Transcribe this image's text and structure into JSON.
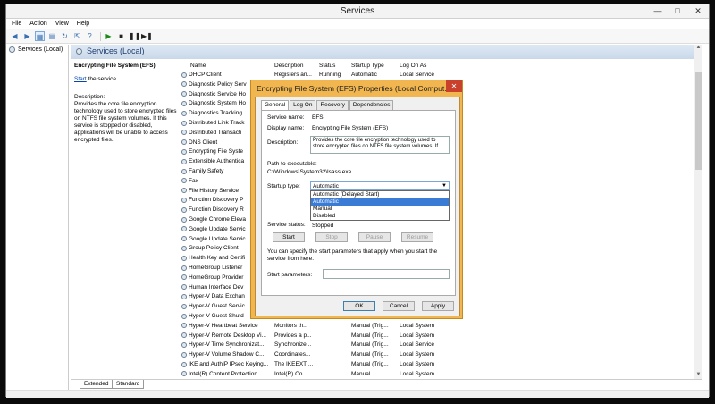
{
  "window": {
    "title": "Services",
    "min_icon": "minimize-icon",
    "max_icon": "maximize-icon",
    "close_icon": "close-icon"
  },
  "menu": [
    "File",
    "Action",
    "View",
    "Help"
  ],
  "toolbar": {
    "icons": [
      "back-icon",
      "forward-icon",
      "show-hide-tree-icon",
      "properties-icon",
      "refresh-icon",
      "export-icon",
      "help-icon",
      "start-icon",
      "stop-icon",
      "pause-icon",
      "restart-icon"
    ]
  },
  "tree": {
    "root": "Services (Local)"
  },
  "panel_header": "Services (Local)",
  "description_pane": {
    "service_title": "Encrypting File System (EFS)",
    "start_link": "Start",
    "start_suffix": " the service",
    "desc_label": "Description:",
    "desc_text": "Provides the core file encryption technology used to store encrypted files on NTFS file system volumes. If this service is stopped or disabled, applications will be unable to access encrypted files."
  },
  "columns": {
    "name": "Name",
    "description": "Description",
    "status": "Status",
    "startup": "Startup Type",
    "logon": "Log On As"
  },
  "services": [
    {
      "name": "DHCP Client",
      "description": "Registers an...",
      "status": "Running",
      "startup": "Automatic",
      "logon": "Local Service"
    },
    {
      "name": "Diagnostic Policy Serv",
      "description": "",
      "status": "",
      "startup": "",
      "logon": ""
    },
    {
      "name": "Diagnostic Service Ho",
      "description": "",
      "status": "",
      "startup": "",
      "logon": ""
    },
    {
      "name": "Diagnostic System Ho",
      "description": "",
      "status": "",
      "startup": "",
      "logon": ""
    },
    {
      "name": "Diagnostics Tracking",
      "description": "",
      "status": "",
      "startup": "",
      "logon": ""
    },
    {
      "name": "Distributed Link Track",
      "description": "",
      "status": "",
      "startup": "",
      "logon": ""
    },
    {
      "name": "Distributed Transacti",
      "description": "",
      "status": "",
      "startup": "",
      "logon": ""
    },
    {
      "name": "DNS Client",
      "description": "",
      "status": "",
      "startup": "",
      "logon": ""
    },
    {
      "name": "Encrypting File Syste",
      "description": "",
      "status": "",
      "startup": "",
      "logon": ""
    },
    {
      "name": "Extensible Authentica",
      "description": "",
      "status": "",
      "startup": "",
      "logon": ""
    },
    {
      "name": "Family Safety",
      "description": "",
      "status": "",
      "startup": "",
      "logon": ""
    },
    {
      "name": "Fax",
      "description": "",
      "status": "",
      "startup": "",
      "logon": ""
    },
    {
      "name": "File History Service",
      "description": "",
      "status": "",
      "startup": "",
      "logon": ""
    },
    {
      "name": "Function Discovery P",
      "description": "",
      "status": "",
      "startup": "",
      "logon": ""
    },
    {
      "name": "Function Discovery R",
      "description": "",
      "status": "",
      "startup": "",
      "logon": ""
    },
    {
      "name": "Google Chrome Eleva",
      "description": "",
      "status": "",
      "startup": "",
      "logon": ""
    },
    {
      "name": "Google Update Servic",
      "description": "",
      "status": "",
      "startup": "",
      "logon": ""
    },
    {
      "name": "Google Update Servic",
      "description": "",
      "status": "",
      "startup": "",
      "logon": ""
    },
    {
      "name": "Group Policy Client",
      "description": "",
      "status": "",
      "startup": "",
      "logon": ""
    },
    {
      "name": "Health Key and Certifi",
      "description": "",
      "status": "",
      "startup": "",
      "logon": ""
    },
    {
      "name": "HomeGroup Listener",
      "description": "",
      "status": "",
      "startup": "",
      "logon": ""
    },
    {
      "name": "HomeGroup Provider",
      "description": "",
      "status": "",
      "startup": "",
      "logon": ""
    },
    {
      "name": "Human Interface Dev",
      "description": "",
      "status": "",
      "startup": "",
      "logon": ""
    },
    {
      "name": "Hyper-V Data Exchan",
      "description": "",
      "status": "",
      "startup": "",
      "logon": ""
    },
    {
      "name": "Hyper-V Guest Servic",
      "description": "",
      "status": "",
      "startup": "",
      "logon": ""
    },
    {
      "name": "Hyper-V Guest Shutd",
      "description": "",
      "status": "",
      "startup": "",
      "logon": ""
    },
    {
      "name": "Hyper-V Heartbeat Service",
      "description": "Monitors th...",
      "status": "",
      "startup": "Manual (Trig...",
      "logon": "Local System"
    },
    {
      "name": "Hyper-V Remote Desktop Vi...",
      "description": "Provides a p...",
      "status": "",
      "startup": "Manual (Trig...",
      "logon": "Local System"
    },
    {
      "name": "Hyper-V Time Synchronizat...",
      "description": "Synchronize...",
      "status": "",
      "startup": "Manual (Trig...",
      "logon": "Local Service"
    },
    {
      "name": "Hyper-V Volume Shadow C...",
      "description": "Coordinates...",
      "status": "",
      "startup": "Manual (Trig...",
      "logon": "Local System"
    },
    {
      "name": "IKE and AuthIP IPsec Keying...",
      "description": "The IKEEXT ...",
      "status": "",
      "startup": "Manual (Trig...",
      "logon": "Local System"
    },
    {
      "name": "Intel(R) Content Protection ...",
      "description": "Intel(R) Co...",
      "status": "",
      "startup": "Manual",
      "logon": "Local System"
    }
  ],
  "view_tabs": [
    "Extended",
    "Standard"
  ],
  "dialog": {
    "title": "Encrypting File System (EFS) Properties (Local Comput...",
    "close_label": "✕",
    "tabs": [
      "General",
      "Log On",
      "Recovery",
      "Dependencies"
    ],
    "service_name_label": "Service name:",
    "service_name": "EFS",
    "display_name_label": "Display name:",
    "display_name": "Encrypting File System (EFS)",
    "description_label": "Description:",
    "description": "Provides the core file encryption technology used to store encrypted files on NTFS file system volumes. If",
    "path_label": "Path to executable:",
    "path": "C:\\Windows\\System32\\lsass.exe",
    "startup_type_label": "Startup type:",
    "startup_type_value": "Automatic",
    "startup_options": [
      "Automatic (Delayed Start)",
      "Automatic",
      "Manual",
      "Disabled"
    ],
    "startup_highlighted_index": 1,
    "service_status_label": "Service status:",
    "service_status": "Stopped",
    "buttons": {
      "start": "Start",
      "stop": "Stop",
      "pause": "Pause",
      "resume": "Resume"
    },
    "hint": "You can specify the start parameters that apply when you start the service from here.",
    "start_params_label": "Start parameters:",
    "start_params_value": "",
    "footer": {
      "ok": "OK",
      "cancel": "Cancel",
      "apply": "Apply"
    }
  }
}
